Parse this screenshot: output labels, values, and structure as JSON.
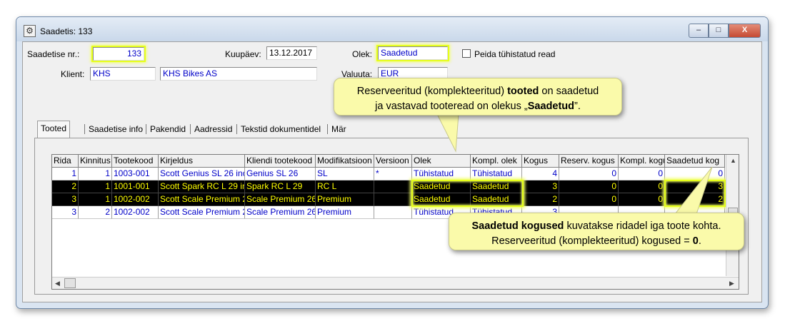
{
  "window": {
    "title": "Saadetis: 133",
    "controls": {
      "minimize": "‒",
      "maximize": "□",
      "close": "X"
    }
  },
  "form": {
    "shipment_no_label": "Saadetise nr.:",
    "shipment_no": "133",
    "date_label": "Kuupäev:",
    "date": "13.12.2017",
    "status_label": "Olek:",
    "status": "Saadetud",
    "hide_cancelled_label": "Peida tühistatud read",
    "client_label": "Klient:",
    "client_code": "KHS",
    "client_name": "KHS Bikes AS",
    "currency_label": "Valuuta:",
    "currency": "EUR"
  },
  "tabs": [
    {
      "label": "Tooted"
    },
    {
      "label": "Saadetise info"
    },
    {
      "label": "Pakendid"
    },
    {
      "label": "Aadressid"
    },
    {
      "label": "Tekstid dokumentidel"
    },
    {
      "label": "Mär"
    }
  ],
  "grid": {
    "columns": [
      "Rida",
      "Kinnitus",
      "Tootekood",
      "Kirjeldus",
      "Kliendi tootekood",
      "Modifikatsioon",
      "Versioon",
      "Olek",
      "Kompl. olek",
      "Kogus",
      "Reserv. kogus",
      "Kompl. kogu",
      "Saadetud kog"
    ],
    "rows": [
      [
        "1",
        "1",
        "1003-001",
        "Scott Genius SL 26 inc",
        "Genius SL 26",
        "SL",
        "*",
        "Tühistatud",
        "Tühistatud",
        "4",
        "0",
        "0",
        "0"
      ],
      [
        "2",
        "1",
        "1001-001",
        "Scott Spark RC L 29 in",
        "Spark RC L 29",
        "RC L",
        "",
        "Saadetud",
        "Saadetud",
        "3",
        "0",
        "0",
        "3"
      ],
      [
        "3",
        "1",
        "1002-002",
        "Scott Scale Premium 2",
        "Scale Premium 26",
        "Premium",
        "",
        "Saadetud",
        "Saadetud",
        "2",
        "0",
        "0",
        "2"
      ],
      [
        "3",
        "2",
        "1002-002",
        "Scott Scale Premium 2",
        "Scale Premium 26",
        "Premium",
        "",
        "Tühistatud",
        "Tühistatud",
        "3",
        "",
        "",
        ""
      ]
    ]
  },
  "callouts": {
    "top": {
      "line1a": "Reserveeritud (komplekteeritud) ",
      "line1b": "tooted",
      "line1c": " on saadetud",
      "line2a": "ja vastavad tooteread on olekus „",
      "line2b": "Saadetud",
      "line2c": "”."
    },
    "bottom": {
      "line1a": "Saadetud kogused",
      "line1b": " kuvatakse ridadel iga toote kohta.",
      "line2a": "Reserveeritud (komplekteeritud) kogused = ",
      "line2b": "0",
      "line2c": "."
    }
  },
  "colors": {
    "highlight": "#e6ff1a",
    "callout_bg": "#fafaaa",
    "value_text": "#0000c8",
    "selected_row_bg": "#000000",
    "selected_row_text": "#ffff00"
  }
}
